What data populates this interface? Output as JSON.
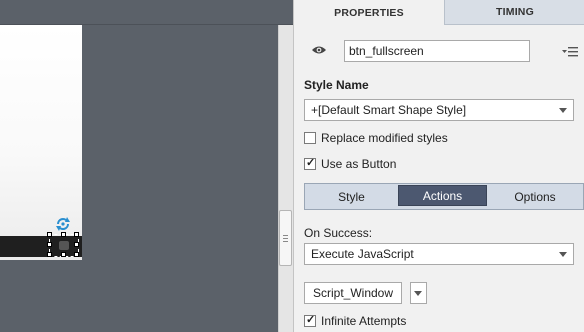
{
  "panel_tabs": {
    "properties": "PROPERTIES",
    "timing": "TIMING"
  },
  "object": {
    "name": "btn_fullscreen",
    "visibility_icon": "eye-icon",
    "menu_icon": "menu-lines-icon"
  },
  "style": {
    "label": "Style Name",
    "selected": "+[Default Smart Shape Style]",
    "replace_modified_label": "Replace modified styles",
    "replace_modified_checked": false,
    "use_as_button_label": "Use as Button",
    "use_as_button_checked": true
  },
  "subtabs": {
    "style": "Style",
    "actions": "Actions",
    "options": "Options",
    "active": "Actions"
  },
  "action": {
    "on_success_label": "On Success:",
    "selected": "Execute JavaScript",
    "script_window_label": "Script_Window",
    "infinite_attempts_label": "Infinite Attempts",
    "infinite_attempts_checked": true
  },
  "colors": {
    "canvas_gray": "#5b6169",
    "active_subtab": "#4c5870",
    "panel_bg": "#f1f1f1",
    "timing_tab_bg": "#d8dee6"
  }
}
